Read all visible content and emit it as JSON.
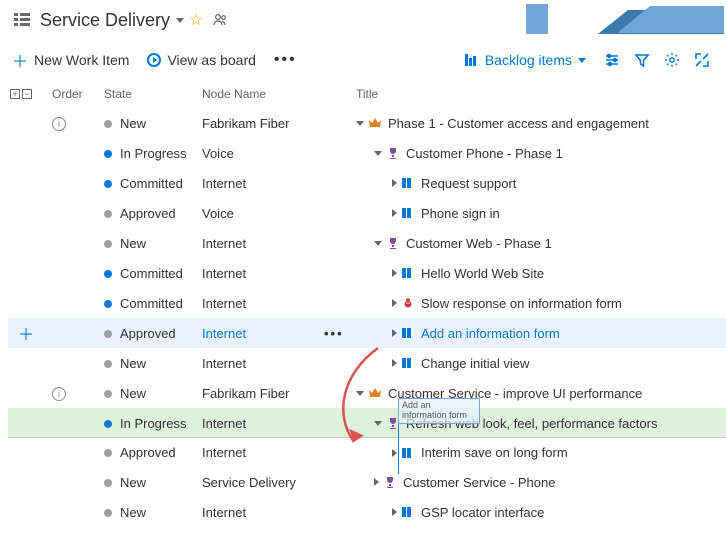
{
  "header": {
    "title": "Service Delivery"
  },
  "toolbar": {
    "new_item": "New Work Item",
    "view_board": "View as board",
    "backlog_items": "Backlog items"
  },
  "columns": {
    "order": "Order",
    "state": "State",
    "node": "Node Name",
    "title": "Title"
  },
  "rows": [
    {
      "info": true,
      "state": "New",
      "dot": "grey",
      "node": "Fabrikam Fiber",
      "title": "Phase 1 - Customer access and engagement",
      "icon": "crown",
      "caret": "down",
      "indent": 0
    },
    {
      "state": "In Progress",
      "dot": "blue",
      "node": "Voice",
      "title": "Customer Phone - Phase 1",
      "icon": "trophy",
      "caret": "down",
      "indent": 1
    },
    {
      "state": "Committed",
      "dot": "blue",
      "node": "Internet",
      "title": "Request support",
      "icon": "pbi",
      "caret": "right",
      "indent": 2
    },
    {
      "state": "Approved",
      "dot": "grey",
      "node": "Voice",
      "title": "Phone sign in",
      "icon": "pbi",
      "caret": "right",
      "indent": 2
    },
    {
      "state": "New",
      "dot": "grey",
      "node": "Internet",
      "title": "Customer Web - Phase 1",
      "icon": "trophy",
      "caret": "down",
      "indent": 1
    },
    {
      "state": "Committed",
      "dot": "blue",
      "node": "Internet",
      "title": "Hello World Web Site",
      "icon": "pbi",
      "caret": "right",
      "indent": 2
    },
    {
      "state": "Committed",
      "dot": "blue",
      "node": "Internet",
      "title": "Slow response on information form",
      "icon": "bug",
      "caret": "right",
      "indent": 2
    },
    {
      "state": "Approved",
      "dot": "grey",
      "node": "Internet",
      "nodelink": true,
      "title": "Add an information form",
      "link": true,
      "icon": "pbi",
      "caret": "right",
      "indent": 2,
      "selected": true,
      "plus": true,
      "dots": true
    },
    {
      "state": "New",
      "dot": "grey",
      "node": "Internet",
      "title": "Change initial view",
      "icon": "pbi",
      "caret": "right",
      "indent": 2
    },
    {
      "info": true,
      "state": "New",
      "dot": "grey",
      "node": "Fabrikam Fiber",
      "title": "Customer Service - improve UI performance",
      "icon": "crown",
      "caret": "down",
      "indent": 0
    },
    {
      "state": "In Progress",
      "dot": "blue",
      "node": "Internet",
      "title": "Refresh web look, feel, performance factors",
      "icon": "trophy",
      "caret": "down",
      "indent": 1,
      "green": true
    },
    {
      "state": "Approved",
      "dot": "grey",
      "node": "Internet",
      "title": "Interim save on long form",
      "icon": "pbi",
      "caret": "right",
      "indent": 2,
      "topline": true
    },
    {
      "state": "New",
      "dot": "grey",
      "node": "Service Delivery",
      "title": "Customer Service - Phone",
      "icon": "trophy",
      "caret": "right",
      "indent": 1
    },
    {
      "state": "New",
      "dot": "grey",
      "node": "Internet",
      "title": "GSP locator interface",
      "icon": "pbi",
      "caret": "right",
      "indent": 2
    }
  ],
  "drag_ghost": "Add an information form",
  "icons": {
    "crown": "♛",
    "trophy": "🏆",
    "bug": "🐞",
    "pbi": "▮▮"
  }
}
